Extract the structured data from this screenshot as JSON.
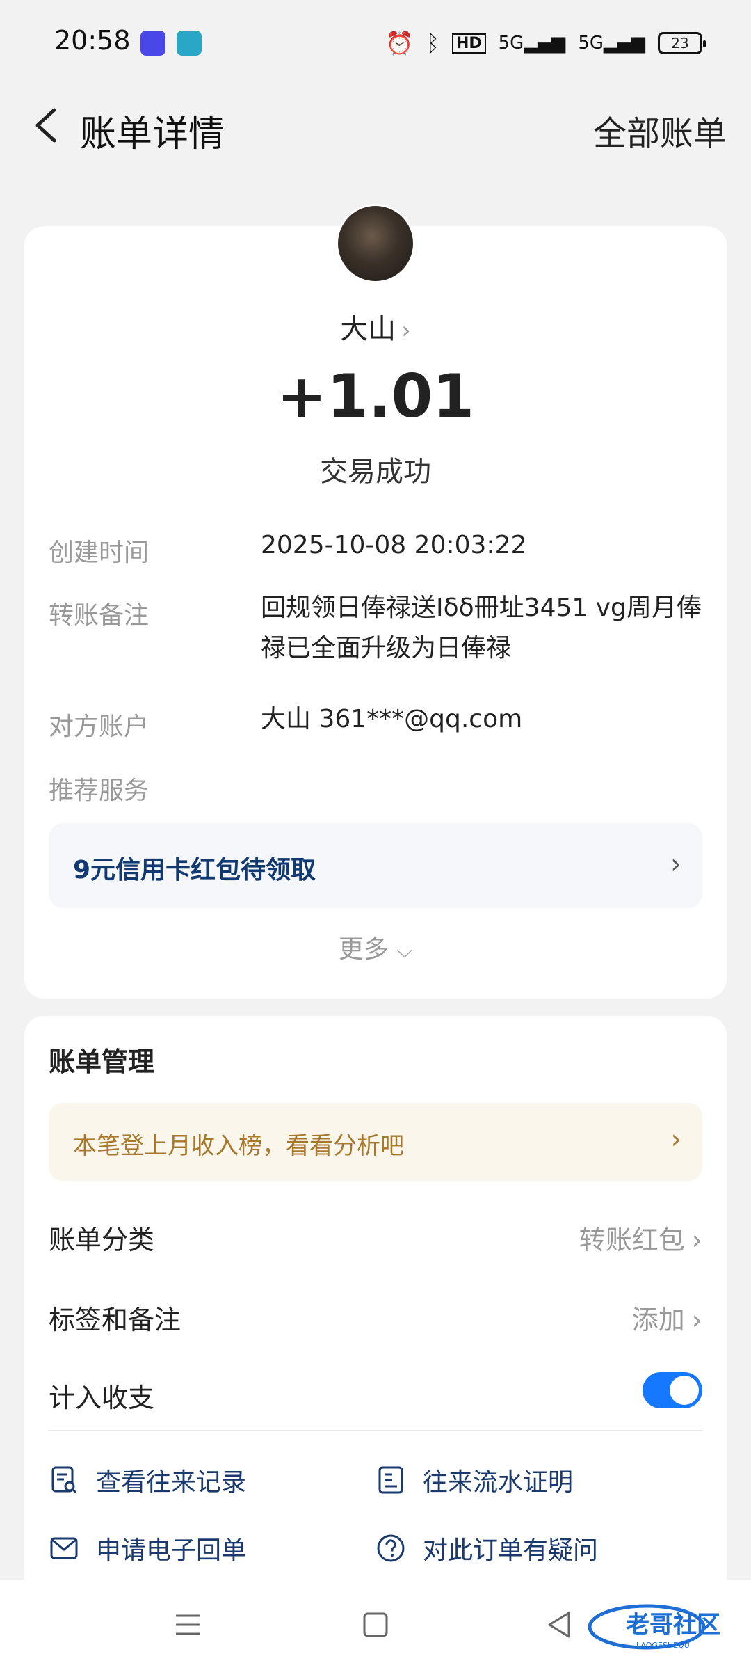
{
  "status_bar": {
    "time": "20:58",
    "icons": [
      "app-flashlight-icon",
      "app-green-icon",
      "alarm-icon",
      "bluetooth-icon",
      "hd-icon",
      "signal-5g-icon",
      "signal-5g-2-icon"
    ],
    "battery_level": "23"
  },
  "header": {
    "title": "账单详情",
    "right_link": "全部账单"
  },
  "transaction": {
    "name": "大山",
    "amount": "+1.01",
    "status": "交易成功"
  },
  "details": {
    "created_label": "创建时间",
    "created_value": "2025-10-08 20:03:22",
    "note_label": "转账备注",
    "note_value": "回规领日俸禄送Iδδ冊址3451 vg周月俸禄已全面升级为日俸禄",
    "account_label": "对方账户",
    "account_value": "大山 361***@qq.com",
    "service_label": "推荐服务"
  },
  "promo": {
    "text": "9元信用卡红包待领取"
  },
  "more_label": "更多",
  "management": {
    "title": "账单管理",
    "notice": "本笔登上月收入榜，看看分析吧",
    "category_label": "账单分类",
    "category_value": "转账红包",
    "tags_label": "标签和备注",
    "tags_value": "添加",
    "count_label": "计入收支",
    "count_enabled": true,
    "actions": {
      "history": "查看往来记录",
      "proof": "往来流水证明",
      "receipt": "申请电子回单",
      "question": "对此订单有疑问"
    }
  },
  "watermark": {
    "text": "老哥社区",
    "sub": "LAOGESHEQU"
  },
  "colors": {
    "accent": "#1677ff",
    "promo_text": "#123a72",
    "notice_bg": "#fbf6ec",
    "notice_text": "#a7782b"
  }
}
